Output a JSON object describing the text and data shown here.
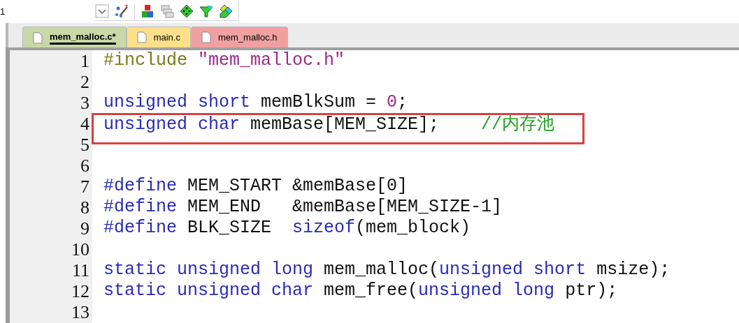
{
  "toolbar": {
    "left_text": "1"
  },
  "tabs": [
    {
      "label": "mem_malloc.c*",
      "selected": true,
      "color": "#c8d8a8"
    },
    {
      "label": "main.c",
      "selected": false,
      "color": "#ffe08a"
    },
    {
      "label": "mem_malloc.h",
      "selected": false,
      "color": "#f0a0a0"
    }
  ],
  "editor": {
    "lines": [
      {
        "number": "1",
        "highlighted": false,
        "tokens": [
          {
            "kind": "directive",
            "text": "#include "
          },
          {
            "kind": "string",
            "text": "\"mem_malloc.h\""
          }
        ]
      },
      {
        "number": "2",
        "highlighted": false
      },
      {
        "number": "3",
        "highlighted": false,
        "tokens": [
          {
            "kind": "keyword",
            "text": "unsigned short"
          },
          {
            "kind": "plain",
            "text": " memBlkSum = "
          },
          {
            "kind": "number",
            "text": "0"
          },
          {
            "kind": "plain",
            "text": ";"
          }
        ]
      },
      {
        "number": "4",
        "highlighted": true,
        "tokens": [
          {
            "kind": "keyword",
            "text": "unsigned char"
          },
          {
            "kind": "plain",
            "text": " memBase[MEM_SIZE];    "
          },
          {
            "kind": "comment",
            "text": "//内存池"
          }
        ]
      },
      {
        "number": "5",
        "highlighted": false
      },
      {
        "number": "6",
        "highlighted": false
      },
      {
        "number": "7",
        "highlighted": false,
        "tokens": [
          {
            "kind": "keyword",
            "text": "#define"
          },
          {
            "kind": "plain",
            "text": " MEM_START &memBase[0]"
          }
        ]
      },
      {
        "number": "8",
        "highlighted": false,
        "tokens": [
          {
            "kind": "keyword",
            "text": "#define"
          },
          {
            "kind": "plain",
            "text": " MEM_END   &memBase[MEM_SIZE-1]"
          }
        ]
      },
      {
        "number": "9",
        "highlighted": false,
        "tokens": [
          {
            "kind": "keyword",
            "text": "#define"
          },
          {
            "kind": "plain",
            "text": " BLK_SIZE  "
          },
          {
            "kind": "keyword",
            "text": "sizeof"
          },
          {
            "kind": "plain",
            "text": "(mem_block)"
          }
        ]
      },
      {
        "number": "10",
        "highlighted": false
      },
      {
        "number": "11",
        "highlighted": false,
        "tokens": [
          {
            "kind": "keyword",
            "text": "static unsigned long"
          },
          {
            "kind": "plain",
            "text": " mem_malloc("
          },
          {
            "kind": "keyword",
            "text": "unsigned short"
          },
          {
            "kind": "plain",
            "text": " msize);"
          }
        ]
      },
      {
        "number": "12",
        "highlighted": false,
        "tokens": [
          {
            "kind": "keyword",
            "text": "static unsigned char"
          },
          {
            "kind": "plain",
            "text": " mem_free("
          },
          {
            "kind": "keyword",
            "text": "unsigned long"
          },
          {
            "kind": "plain",
            "text": " ptr);"
          }
        ]
      },
      {
        "number": "13",
        "highlighted": false
      }
    ]
  }
}
